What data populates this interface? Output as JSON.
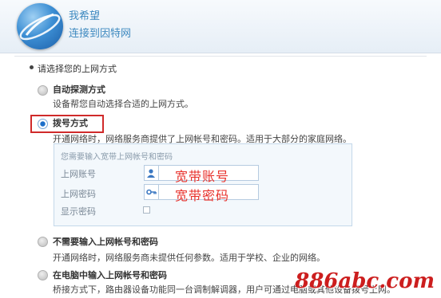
{
  "header": {
    "title": "我希望",
    "subtitle": "连接到因特网"
  },
  "prompt": "请选择您的上网方式",
  "options": [
    {
      "label": "自动探测方式",
      "description": "设备帮您自动选择合适的上网方式。",
      "selected": false
    },
    {
      "label": "拨号方式",
      "description": "开通网络时，网络服务商提供了上网帐号和密码。适用于大部分的家庭网络。",
      "selected": true
    },
    {
      "label": "不需要输入上网帐号和密码",
      "description": "开通网络时，网络服务商未提供任何参数。适用于学校、企业的网络。",
      "selected": false
    },
    {
      "label": "在电脑中输入上网帐号和密码",
      "description": "桥接方式下，路由器设备功能同一台调制解调器，用户可通过电脑或其他设备拨号上网。",
      "selected": false
    }
  ],
  "dialup_panel": {
    "title": "您需要输入宽带上网帐号和密码",
    "account_label": "上网账号",
    "account_value": "宽带账号",
    "password_label": "上网密码",
    "password_value": "宽带密码",
    "show_password_label": "显示密码",
    "show_password_checked": false
  },
  "watermark": "886abc.com",
  "colors": {
    "header_text": "#3f8ac0",
    "highlight_box": "#d02a2a",
    "field_value": "#e8322c",
    "panel_bg": "#f3f8fc",
    "selected_radio": "#1d6fc9"
  },
  "icons": {
    "account": "user-icon",
    "password": "key-icon"
  }
}
